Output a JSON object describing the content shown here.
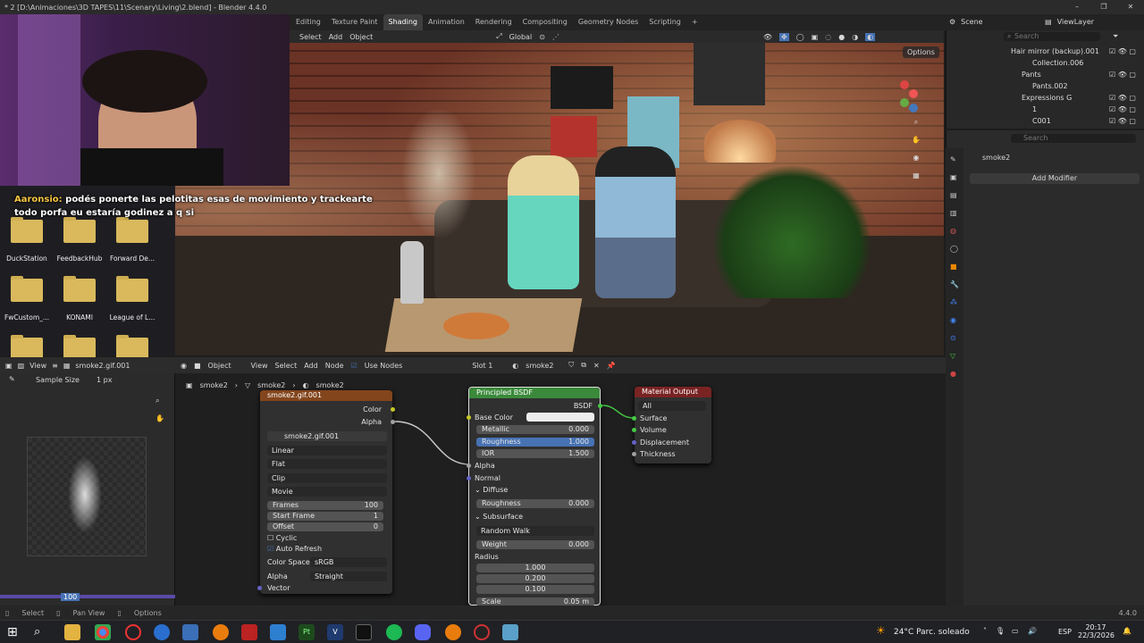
{
  "window": {
    "title": "* 2 [D:\\Animaciones\\3D TAPES\\11\\Scenary\\Living\\2.blend] - Blender 4.4.0"
  },
  "workspaces": [
    "Editing",
    "Texture Paint",
    "Shading",
    "Animation",
    "Rendering",
    "Compositing",
    "Geometry Nodes",
    "Scripting"
  ],
  "workspace_active": "Shading",
  "scene": "Scene",
  "view_layer": "ViewLayer",
  "viewport": {
    "menu": [
      "Select",
      "Add",
      "Object"
    ],
    "orientation": "Global",
    "options": "Options"
  },
  "chat": {
    "user": "Aaronsio:",
    "message": "podés ponerte las pelotitas esas de movimiento y trackearte todo porfa eu estaría godinez a q si"
  },
  "desktop": {
    "folders": [
      "DuckStation",
      "FeedbackHub",
      "Forward De...",
      "FwCustom_...",
      "KONAMI",
      "League of L..."
    ]
  },
  "outliner": {
    "search_placeholder": "Search",
    "rows": [
      "Hair mirror (backup).001",
      "Collection.006",
      "Pants",
      "Pants.002",
      "Expressions G",
      "1",
      "C001"
    ]
  },
  "properties": {
    "search_placeholder": "Search",
    "object": "smoke2",
    "add_modifier": "Add Modifier"
  },
  "image_editor": {
    "view": "View",
    "image": "smoke2.gif.001",
    "sample_size_label": "Sample Size",
    "sample_size_value": "1 px",
    "frame": "100"
  },
  "node_editor": {
    "mode": "Object",
    "menu": [
      "View",
      "Select",
      "Add",
      "Node"
    ],
    "use_nodes": "Use Nodes",
    "slot": "Slot 1",
    "material": "smoke2",
    "breadcrumb": [
      "smoke2",
      "smoke2",
      "smoke2"
    ]
  },
  "image_node": {
    "title": "smoke2.gif.001",
    "outputs": [
      "Color",
      "Alpha"
    ],
    "image": "smoke2.gif.001",
    "interpolation": "Linear",
    "projection": "Flat",
    "extension": "Clip",
    "source": "Movie",
    "frames_label": "Frames",
    "frames": "100",
    "start_label": "Start Frame",
    "start": "1",
    "offset_label": "Offset",
    "offset": "0",
    "cyclic": "Cyclic",
    "auto_refresh": "Auto Refresh",
    "color_space_label": "Color Space",
    "color_space": "sRGB",
    "alpha_label": "Alpha",
    "alpha": "Straight",
    "vector": "Vector"
  },
  "bsdf_node": {
    "title": "Principled BSDF",
    "output": "BSDF",
    "base_color": "Base Color",
    "metallic_label": "Metallic",
    "metallic": "0.000",
    "roughness_label": "Roughness",
    "roughness": "1.000",
    "ior_label": "IOR",
    "ior": "1.500",
    "alpha": "Alpha",
    "normal": "Normal",
    "diffuse": "Diffuse",
    "diff_rough_label": "Roughness",
    "diff_rough": "0.000",
    "subsurface": "Subsurface",
    "method": "Random Walk",
    "weight_label": "Weight",
    "weight": "0.000",
    "radius": "Radius",
    "r1": "1.000",
    "r2": "0.200",
    "r3": "0.100",
    "scale_label": "Scale",
    "scale": "0.05 m"
  },
  "output_node": {
    "title": "Material Output",
    "target": "All",
    "inputs": [
      "Surface",
      "Volume",
      "Displacement",
      "Thickness"
    ]
  },
  "statusbar": {
    "items": [
      "Select",
      "Pan View",
      "Options"
    ],
    "version": "4.4.0"
  },
  "taskbar": {
    "weather": "24°C  Parc. soleado",
    "lang": "ESP",
    "time": "20:17",
    "date": "22/3/2026"
  },
  "colors": {
    "accent": "#4772b3",
    "bsdf_head": "#3b8a3b",
    "tex_head": "#83451c",
    "out_head": "#7a2323"
  }
}
